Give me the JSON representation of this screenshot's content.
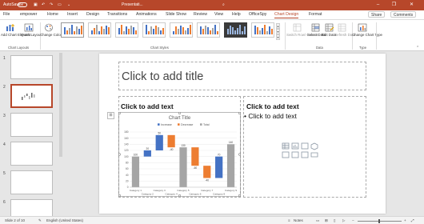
{
  "titlebar": {
    "autosave_label": "AutoSave",
    "autosave_state": "Off",
    "filename": "Presentati...",
    "window_controls": [
      "minimize-icon",
      "restore-icon",
      "close-icon"
    ],
    "accent_color": "#b7472a"
  },
  "tabs": {
    "items": [
      {
        "label": "File",
        "active": false
      },
      {
        "label": "empower",
        "active": false
      },
      {
        "label": "Home",
        "active": false
      },
      {
        "label": "Insert",
        "active": false
      },
      {
        "label": "Design",
        "active": false
      },
      {
        "label": "Transitions",
        "active": false
      },
      {
        "label": "Animations",
        "active": false
      },
      {
        "label": "Slide Show",
        "active": false
      },
      {
        "label": "Review",
        "active": false
      },
      {
        "label": "View",
        "active": false
      },
      {
        "label": "Help",
        "active": false
      },
      {
        "label": "OfficeSpy",
        "active": false
      },
      {
        "label": "Chart Design",
        "active": true
      },
      {
        "label": "Format",
        "active": false
      }
    ],
    "share_label": "Share",
    "comments_label": "Comments"
  },
  "ribbon": {
    "add_chart_element": "Add Chart Element",
    "quick_layout": "Quick Layout",
    "change_colors": "Change Colors",
    "chart_layouts_group": "Chart Layouts",
    "chart_styles_group": "Chart Styles",
    "switch_row_column": "Switch Row/ Column",
    "select_data": "Select Data",
    "edit_data": "Edit Data",
    "refresh_data": "Refresh Data",
    "data_group": "Data",
    "change_chart_type": "Change Chart Type",
    "type_group": "Type"
  },
  "slides_pane": {
    "numbers": [
      "1",
      "2",
      "3",
      "4",
      "5",
      "6"
    ],
    "selected": 2
  },
  "slide": {
    "title_placeholder": "Click to add title",
    "left_header": "Click to add text",
    "right_header": "Click to add text",
    "right_bullet": "Click to add text"
  },
  "chart_data": {
    "type": "bar",
    "title": "Chart Title",
    "legend": [
      "Increase",
      "Decrease",
      "Total"
    ],
    "legend_placement": "top",
    "colors": {
      "Increase": "#4472c4",
      "Decrease": "#ed7d31",
      "Total": "#a5a5a5"
    },
    "ylim": [
      0,
      180
    ],
    "y_ticks": [
      "180",
      "160",
      "140",
      "120",
      "100",
      "80",
      "60",
      "40",
      "20",
      "0"
    ],
    "categories": [
      "Category 1",
      "Category 2",
      "Category 3",
      "Category 4",
      "Category 5",
      "Category 6",
      "Category 7",
      "Category 8",
      "Category 9"
    ],
    "series": [
      {
        "name": "Total",
        "values": [
          100,
          null,
          null,
          null,
          130,
          null,
          null,
          null,
          140
        ]
      },
      {
        "name": "Increase",
        "values": [
          null,
          20,
          50,
          null,
          null,
          null,
          null,
          70,
          null
        ]
      },
      {
        "name": "Decrease",
        "values": [
          null,
          null,
          null,
          -40,
          null,
          -60,
          -40,
          null,
          null
        ]
      }
    ],
    "data_labels": [
      "100",
      "20",
      "50",
      "-40",
      "130",
      "-60",
      "-40",
      "70",
      "140"
    ],
    "grid": true
  },
  "status_bar": {
    "slide_info": "Slide 2 of 10",
    "language": "English (United States)",
    "notes_label": "Notes"
  }
}
